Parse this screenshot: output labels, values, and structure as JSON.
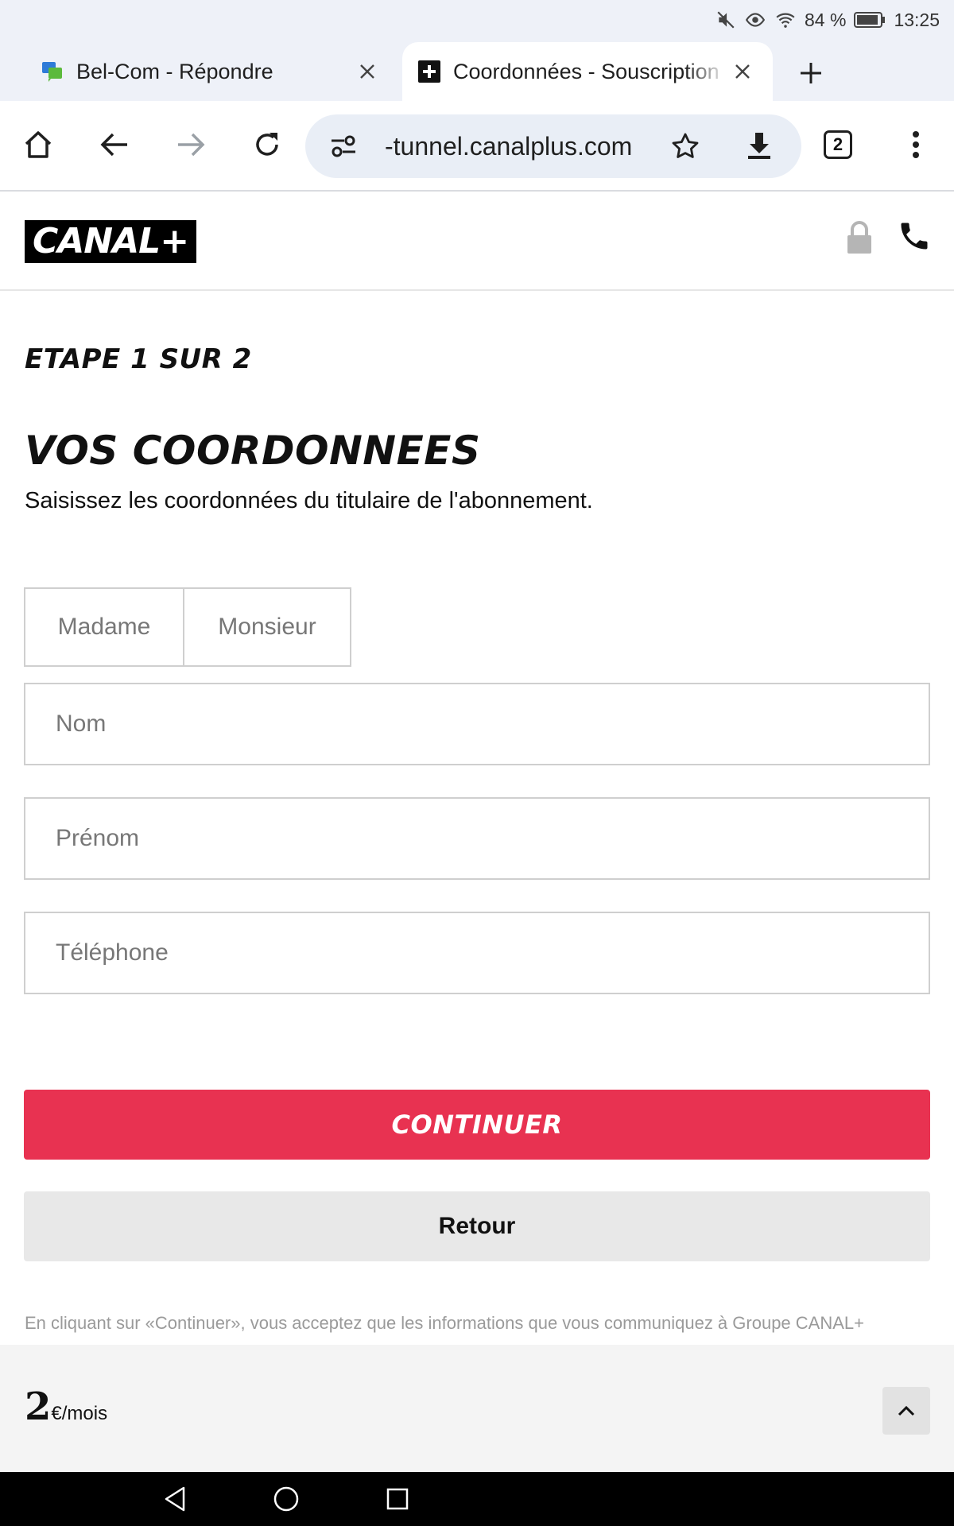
{
  "status_bar": {
    "battery": "84 %",
    "time": "13:25"
  },
  "tabs": [
    {
      "title": "Bel-Com - Répondre",
      "active": false
    },
    {
      "title": "Coordonnées - Souscription",
      "active": true
    }
  ],
  "toolbar": {
    "url": "-tunnel.canalplus.com",
    "tab_count": "2"
  },
  "site": {
    "logo_text": "CANAL+",
    "step": "ETAPE 1 SUR 2",
    "title": "VOS COORDONNEES",
    "subtitle": "Saisissez les coordonnées du titulaire de l'abonnement."
  },
  "form": {
    "civility_options": [
      "Madame",
      "Monsieur"
    ],
    "last_name_placeholder": "Nom",
    "first_name_placeholder": "Prénom",
    "phone_placeholder": "Téléphone",
    "continue_label": "CONTINUER",
    "back_label": "Retour"
  },
  "legal_text": "En cliquant sur «Continuer», vous acceptez que les informations que vous communiquez à Groupe CANAL+",
  "price_bar": {
    "amount": "2",
    "unit": "€/mois"
  },
  "colors": {
    "accent": "#e83251",
    "chrome_bg": "#eef1f8",
    "omnibox_bg": "#e9eef6"
  }
}
